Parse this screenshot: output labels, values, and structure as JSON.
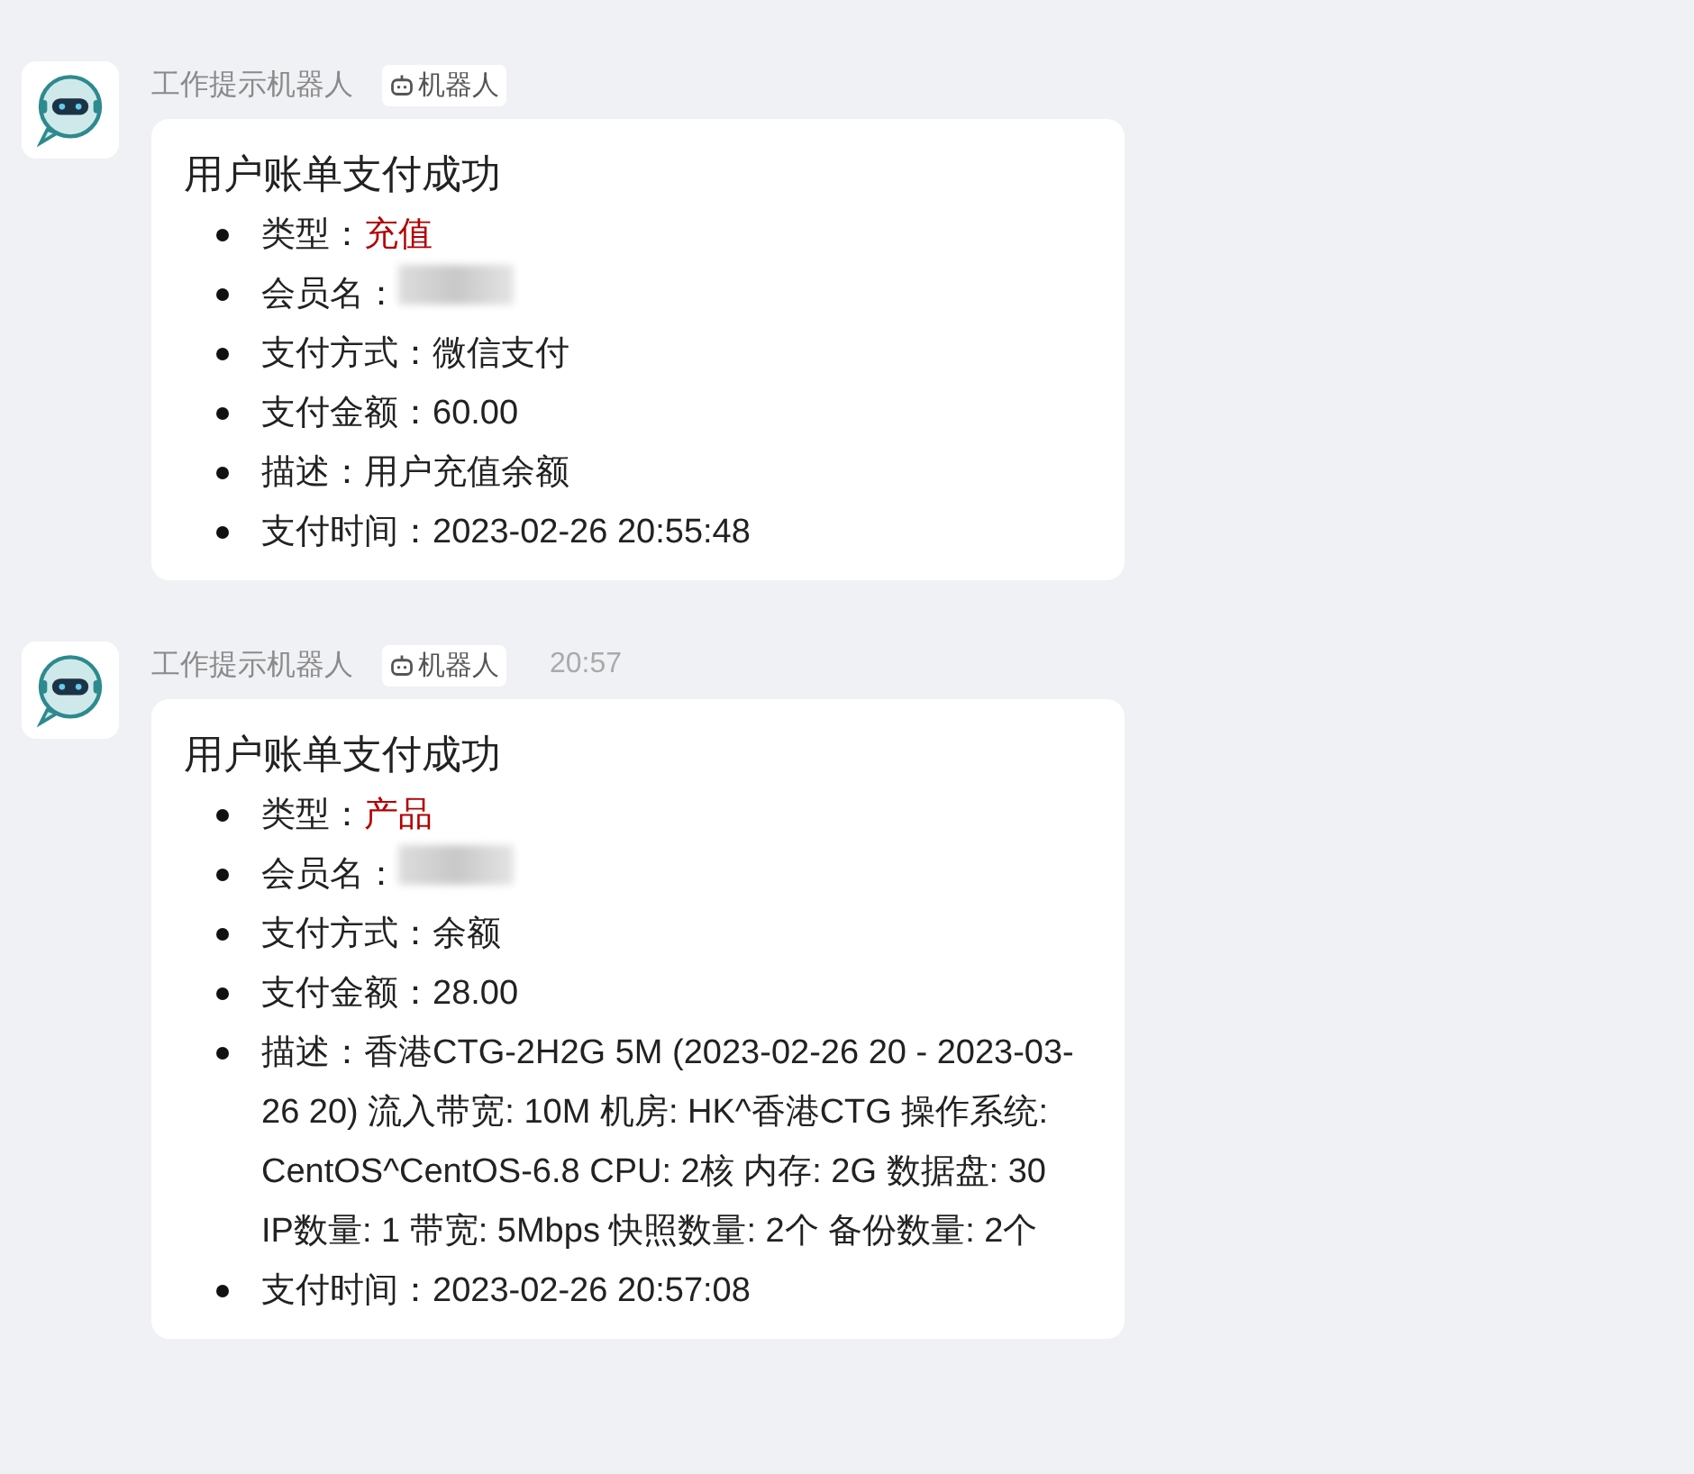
{
  "messages": [
    {
      "sender": "工作提示机器人",
      "badge": "机器人",
      "title": "用户账单支付成功",
      "items": [
        {
          "kind": "plain",
          "label": "类型：",
          "value": "充值",
          "highlight": true
        },
        {
          "kind": "redacted",
          "label": "会员名："
        },
        {
          "kind": "plain",
          "label": "支付方式：",
          "value": "微信支付",
          "highlight": false
        },
        {
          "kind": "plain",
          "label": "支付金额：",
          "value": "60.00",
          "highlight": false
        },
        {
          "kind": "plain",
          "label": "描述：",
          "value": "用户充值余额",
          "highlight": false
        },
        {
          "kind": "plain",
          "label": "支付时间：",
          "value": "2023-02-26 20:55:48",
          "highlight": false
        }
      ]
    },
    {
      "sender": "工作提示机器人",
      "badge": "机器人",
      "time": "20:57",
      "title": "用户账单支付成功",
      "items": [
        {
          "kind": "plain",
          "label": "类型：",
          "value": "产品",
          "highlight": true
        },
        {
          "kind": "redacted",
          "label": "会员名："
        },
        {
          "kind": "plain",
          "label": "支付方式：",
          "value": "余额",
          "highlight": false
        },
        {
          "kind": "plain",
          "label": "支付金额：",
          "value": "28.00",
          "highlight": false
        },
        {
          "kind": "plain",
          "label": "描述：",
          "value": "香港CTG-2H2G 5M (2023-02-26 20 - 2023-03-26 20) 流入带宽: 10M 机房: HK^香港CTG 操作系统: CentOS^CentOS-6.8 CPU: 2核 内存: 2G 数据盘: 30 IP数量: 1 带宽: 5Mbps 快照数量: 2个 备份数量: 2个",
          "highlight": false
        },
        {
          "kind": "plain",
          "label": "支付时间：",
          "value": "2023-02-26 20:57:08",
          "highlight": false
        }
      ]
    }
  ]
}
